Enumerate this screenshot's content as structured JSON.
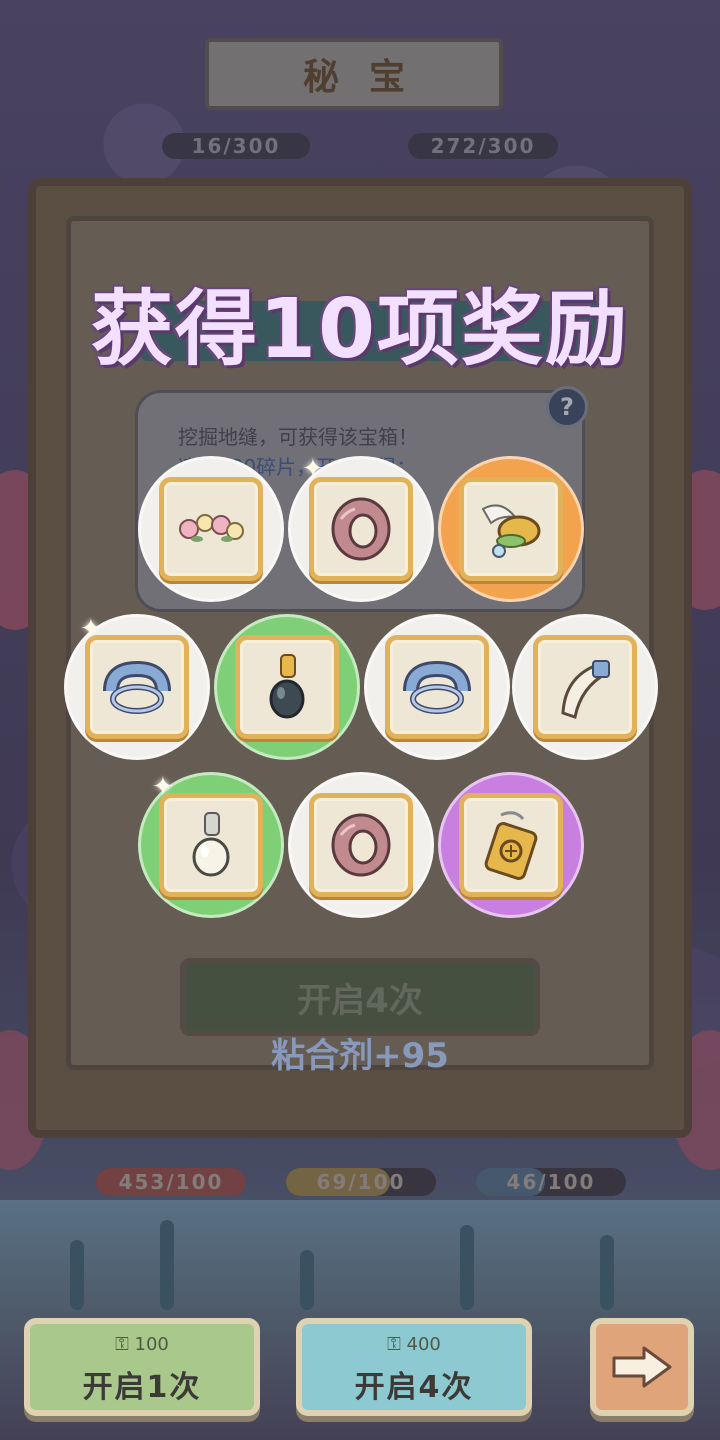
{
  "screen_title": "秘宝",
  "top_progress": [
    "16/300",
    "272/300"
  ],
  "panel": {
    "tooltip_line1": "挖掘地缝，可获得该宝箱！",
    "tooltip_line2": "凑齐100碎片，开启获得：",
    "help_label": "?",
    "open_button_label": "开启4次",
    "glue_text": "粘合剂+95"
  },
  "overlay_title": "获得10项奖励",
  "rewards": [
    {
      "name": "flower-crown",
      "rarity": "common"
    },
    {
      "name": "pink-ring",
      "rarity": "common"
    },
    {
      "name": "winged-helmet",
      "rarity": "legendary"
    },
    {
      "name": "blue-bracelet",
      "rarity": "common"
    },
    {
      "name": "dark-pearl-pendant",
      "rarity": "uncommon"
    },
    {
      "name": "blue-bracelet",
      "rarity": "common"
    },
    {
      "name": "tooth-charm",
      "rarity": "common"
    },
    {
      "name": "white-pearl-pendant",
      "rarity": "uncommon"
    },
    {
      "name": "pink-ring",
      "rarity": "common"
    },
    {
      "name": "gold-amulet",
      "rarity": "epic"
    }
  ],
  "rarity_colors": {
    "common": "#f2f0ec",
    "uncommon": "#7fcf76",
    "legendary": "#f3a24e",
    "epic": "#c97fe0"
  },
  "stats": [
    {
      "text": "453/100",
      "color": "#c0504a"
    },
    {
      "text": "69/100",
      "color": "#d6b24a"
    },
    {
      "text": "46/100",
      "color": "#6aa0c8"
    }
  ],
  "footer": {
    "open_once": {
      "cost": "100",
      "label": "开启1次"
    },
    "open_four": {
      "cost": "400",
      "label": "开启4次"
    }
  }
}
